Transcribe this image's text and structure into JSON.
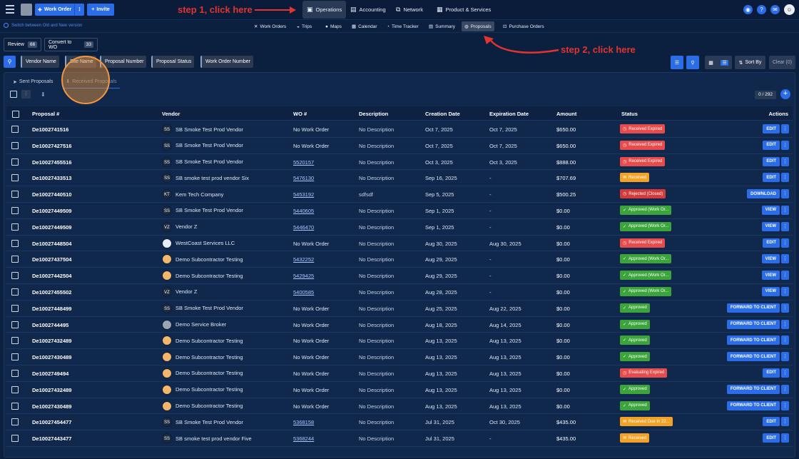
{
  "topbar": {
    "work_order_label": "Work Order",
    "invite_label": "Invite",
    "nav": [
      {
        "label": "Operations",
        "icon": "building-icon",
        "active": true
      },
      {
        "label": "Accounting",
        "icon": "wallet-icon",
        "active": false
      },
      {
        "label": "Network",
        "icon": "network-icon",
        "active": false
      },
      {
        "label": "Product & Services",
        "icon": "briefcase-icon",
        "active": false
      }
    ]
  },
  "annotations": {
    "step1": "step 1, click here",
    "step2": "step 2, click here"
  },
  "subbar": {
    "switch_label": "Switch between Old and New version",
    "nav": [
      "Work Orders",
      "Trips",
      "Maps",
      "Calendar",
      "Time Tracker",
      "Summary",
      "Proposals",
      "Purchase Orders"
    ],
    "active": "Proposals"
  },
  "review": {
    "label": "Review",
    "count": "66"
  },
  "convert": {
    "label": "Convert to WO",
    "count": "33"
  },
  "filters": [
    "Vendor Name",
    "Site Name",
    "Proposal Number",
    "Proposal Status",
    "Work Order Number"
  ],
  "sort_label": "Sort By",
  "clear_label": "Clear (0)",
  "tabs": {
    "sent": "Sent Proposals",
    "received": "Received Proposals"
  },
  "pagination": "0 / 292",
  "columns": {
    "proposal": "Proposal #",
    "vendor": "Vendor",
    "wo": "WO #",
    "description": "Description",
    "creation": "Creation Date",
    "expiration": "Expiration Date",
    "amount": "Amount",
    "status": "Status",
    "actions": "Actions"
  },
  "rows": [
    {
      "proposal": "De1002741516",
      "avatar": "SS",
      "avatar_type": "dark",
      "vendor": "SB Smoke Test Prod Vendor",
      "wo": "No Work Order",
      "wo_link": false,
      "desc": "No Description",
      "created": "Oct 7, 2025",
      "expires": "Oct 7, 2025",
      "amount": "$650.00",
      "status": "Received Expired",
      "status_color": "red",
      "action": "EDIT"
    },
    {
      "proposal": "De10027427516",
      "avatar": "SS",
      "avatar_type": "dark",
      "vendor": "SB Smoke Test Prod Vendor",
      "wo": "No Work Order",
      "wo_link": false,
      "desc": "No Description",
      "created": "Oct 7, 2025",
      "expires": "Oct 7, 2025",
      "amount": "$650.00",
      "status": "Received Expired",
      "status_color": "red",
      "action": "EDIT"
    },
    {
      "proposal": "De10027455516",
      "avatar": "SS",
      "avatar_type": "dark",
      "vendor": "SB Smoke Test Prod Vendor",
      "wo": "5520157",
      "wo_link": true,
      "desc": "No Description",
      "created": "Oct 3, 2025",
      "expires": "Oct 3, 2025",
      "amount": "$888.00",
      "status": "Received Expired",
      "status_color": "red",
      "action": "EDIT"
    },
    {
      "proposal": "De10027433513",
      "avatar": "SS",
      "avatar_type": "dark",
      "vendor": "SB smoke test prod vendor Six",
      "wo": "5476130",
      "wo_link": true,
      "desc": "No Description",
      "created": "Sep 16, 2025",
      "expires": "-",
      "amount": "$707.69",
      "status": "Received",
      "status_color": "orange",
      "action": "EDIT"
    },
    {
      "proposal": "De10027440510",
      "avatar": "KT",
      "avatar_type": "dark",
      "vendor": "Kem Tech Company",
      "wo": "5453192",
      "wo_link": true,
      "desc": "sdfsdf",
      "created": "Sep 5, 2025",
      "expires": "-",
      "amount": "$500.25",
      "status": "Rejected (Closed)",
      "status_color": "rej",
      "action": "DOWNLOAD"
    },
    {
      "proposal": "De10027449509",
      "avatar": "SS",
      "avatar_type": "dark",
      "vendor": "SB Smoke Test Prod Vendor",
      "wo": "5440605",
      "wo_link": true,
      "desc": "No Description",
      "created": "Sep 1, 2025",
      "expires": "-",
      "amount": "$0.00",
      "status": "Approved (Work Or...",
      "status_color": "green",
      "action": "VIEW"
    },
    {
      "proposal": "De10027449509",
      "avatar": "VZ",
      "avatar_type": "dark",
      "vendor": "Vendor Z",
      "wo": "5446470",
      "wo_link": true,
      "desc": "No Description",
      "created": "Sep 1, 2025",
      "expires": "-",
      "amount": "$0.00",
      "status": "Approved (Work Or...",
      "status_color": "green",
      "action": "VIEW"
    },
    {
      "proposal": "De10027448504",
      "avatar": "",
      "avatar_type": "img",
      "vendor": "WestCoast Services LLC",
      "wo": "No Work Order",
      "wo_link": false,
      "desc": "No Description",
      "created": "Aug 30, 2025",
      "expires": "Aug 30, 2025",
      "amount": "$0.00",
      "status": "Received Expired",
      "status_color": "red",
      "action": "EDIT"
    },
    {
      "proposal": "De10027437504",
      "avatar": "",
      "avatar_type": "orange",
      "vendor": "Demo Subcontractor Testing",
      "wo": "5432252",
      "wo_link": true,
      "desc": "No Description",
      "created": "Aug 29, 2025",
      "expires": "-",
      "amount": "$0.00",
      "status": "Approved (Work Or...",
      "status_color": "green",
      "action": "VIEW"
    },
    {
      "proposal": "De10027442504",
      "avatar": "",
      "avatar_type": "orange",
      "vendor": "Demo Subcontractor Testing",
      "wo": "5429425",
      "wo_link": true,
      "desc": "No Description",
      "created": "Aug 29, 2025",
      "expires": "-",
      "amount": "$0.00",
      "status": "Approved (Work Or...",
      "status_color": "green",
      "action": "VIEW"
    },
    {
      "proposal": "De10027455502",
      "avatar": "VZ",
      "avatar_type": "dark",
      "vendor": "Vendor Z",
      "wo": "5400585",
      "wo_link": true,
      "desc": "No Description",
      "created": "Aug 28, 2025",
      "expires": "-",
      "amount": "$0.00",
      "status": "Approved (Work Or...",
      "status_color": "green",
      "action": "VIEW"
    },
    {
      "proposal": "De10027448499",
      "avatar": "SS",
      "avatar_type": "dark",
      "vendor": "SB Smoke Test Prod Vendor",
      "wo": "No Work Order",
      "wo_link": false,
      "desc": "No Description",
      "created": "Aug 25, 2025",
      "expires": "Aug 22, 2025",
      "amount": "$0.00",
      "status": "Approved",
      "status_color": "green",
      "action": "FORWARD TO CLIENT"
    },
    {
      "proposal": "De1002744495",
      "avatar": "",
      "avatar_type": "gray",
      "vendor": "Demo Service Broker",
      "wo": "No Work Order",
      "wo_link": false,
      "desc": "No Description",
      "created": "Aug 18, 2025",
      "expires": "Aug 14, 2025",
      "amount": "$0.00",
      "status": "Approved",
      "status_color": "green",
      "action": "FORWARD TO CLIENT"
    },
    {
      "proposal": "De10027432489",
      "avatar": "",
      "avatar_type": "orange",
      "vendor": "Demo Subcontractor Testing",
      "wo": "No Work Order",
      "wo_link": false,
      "desc": "No Description",
      "created": "Aug 13, 2025",
      "expires": "Aug 13, 2025",
      "amount": "$0.00",
      "status": "Approved",
      "status_color": "green",
      "action": "FORWARD TO CLIENT"
    },
    {
      "proposal": "De10027430489",
      "avatar": "",
      "avatar_type": "orange",
      "vendor": "Demo Subcontractor Testing",
      "wo": "No Work Order",
      "wo_link": false,
      "desc": "No Description",
      "created": "Aug 13, 2025",
      "expires": "Aug 13, 2025",
      "amount": "$0.00",
      "status": "Approved",
      "status_color": "green",
      "action": "FORWARD TO CLIENT"
    },
    {
      "proposal": "De1002749494",
      "avatar": "",
      "avatar_type": "orange",
      "vendor": "Demo Subcontractor Testing",
      "wo": "No Work Order",
      "wo_link": false,
      "desc": "No Description",
      "created": "Aug 13, 2025",
      "expires": "Aug 13, 2025",
      "amount": "$0.00",
      "status": "Evaluating Expired",
      "status_color": "red",
      "action": "EDIT"
    },
    {
      "proposal": "De10027432489",
      "avatar": "",
      "avatar_type": "orange",
      "vendor": "Demo Subcontractor Testing",
      "wo": "No Work Order",
      "wo_link": false,
      "desc": "No Description",
      "created": "Aug 13, 2025",
      "expires": "Aug 13, 2025",
      "amount": "$0.00",
      "status": "Approved",
      "status_color": "green",
      "action": "FORWARD TO CLIENT"
    },
    {
      "proposal": "De10027430489",
      "avatar": "",
      "avatar_type": "orange",
      "vendor": "Demo Subcontractor Testing",
      "wo": "No Work Order",
      "wo_link": false,
      "desc": "No Description",
      "created": "Aug 13, 2025",
      "expires": "Aug 13, 2025",
      "amount": "$0.00",
      "status": "Approved",
      "status_color": "green",
      "action": "FORWARD TO CLIENT"
    },
    {
      "proposal": "De10027454477",
      "avatar": "SS",
      "avatar_type": "dark",
      "vendor": "SB Smoke Test Prod Vendor",
      "wo": "5368158",
      "wo_link": true,
      "desc": "No Description",
      "created": "Jul 31, 2025",
      "expires": "Oct 30, 2025",
      "amount": "$435.00",
      "status": "Received Due In 22...",
      "status_color": "orange",
      "action": "EDIT"
    },
    {
      "proposal": "De10027443477",
      "avatar": "SS",
      "avatar_type": "dark",
      "vendor": "SB smoke test prod vendor Five",
      "wo": "5368244",
      "wo_link": true,
      "desc": "No Description",
      "created": "Jul 31, 2025",
      "expires": "-",
      "amount": "$435.00",
      "status": "Received",
      "status_color": "orange",
      "action": "EDIT"
    }
  ]
}
